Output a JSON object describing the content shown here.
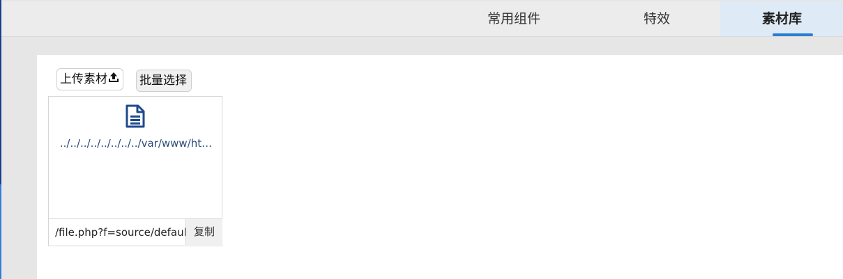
{
  "topbar": {
    "tabs": [
      {
        "label": "常用组件"
      },
      {
        "label": "特效"
      },
      {
        "label": "素材库",
        "active": true
      }
    ]
  },
  "toolbar": {
    "upload_label": "上传素材",
    "upload_icon": "upload-icon",
    "batch_label": "批量选择"
  },
  "files": [
    {
      "icon": "document-icon",
      "name": "../../../../../../../../var/www/ht…",
      "url": "/file.php?f=source/default",
      "copy_label": "复制"
    }
  ],
  "colors": {
    "accent": "#2b7cd3",
    "active_tab_bg": "#deebf7",
    "file_name": "#2b4a7a"
  }
}
